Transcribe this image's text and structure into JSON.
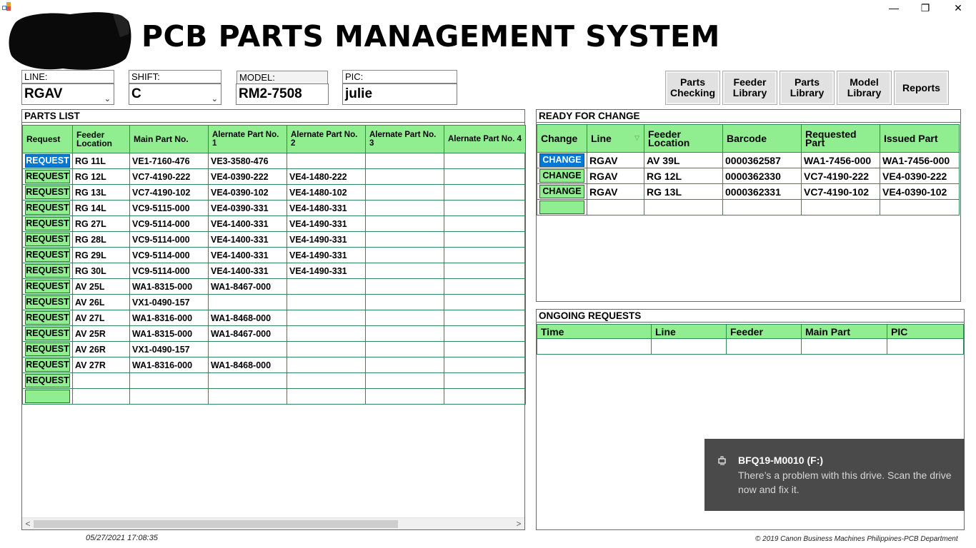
{
  "window": {
    "minimize_glyph": "—",
    "restore_glyph": "❐",
    "close_glyph": "✕"
  },
  "app_title": "PCB PARTS MANAGEMENT SYSTEM",
  "fields": {
    "line": {
      "label": "LINE:",
      "value": "RGAV"
    },
    "shift": {
      "label": "SHIFT:",
      "value": "C"
    },
    "model": {
      "label": "MODEL:",
      "value": "RM2-7508"
    },
    "pic": {
      "label": "PIC:",
      "value": "julie"
    }
  },
  "nav_buttons": [
    "Parts\nChecking",
    "Feeder\nLibrary",
    "Parts\nLibrary",
    "Model\nLibrary",
    "Reports"
  ],
  "parts_list": {
    "title": "PARTS LIST",
    "columns": [
      "Request",
      "Feeder Location",
      "Main Part No.",
      "Alernate Part No. 1",
      "Alernate Part No. 2",
      "Alernate Part No. 3",
      "Alernate Part No. 4"
    ],
    "button_label": "REQUEST",
    "rows": [
      {
        "feeder": "RG 11L",
        "main": "VE1-7160-476",
        "alt1": "VE3-3580-476",
        "alt2": "",
        "alt3": "",
        "alt4": "",
        "btn": "REQUEST"
      },
      {
        "feeder": "RG 12L",
        "main": "VC7-4190-222",
        "alt1": "VE4-0390-222",
        "alt2": "VE4-1480-222",
        "alt3": "",
        "alt4": "",
        "btn": "REQUEST"
      },
      {
        "feeder": "RG 13L",
        "main": "VC7-4190-102",
        "alt1": "VE4-0390-102",
        "alt2": "VE4-1480-102",
        "alt3": "",
        "alt4": "",
        "btn": "REQUEST"
      },
      {
        "feeder": "RG 14L",
        "main": "VC9-5115-000",
        "alt1": "VE4-0390-331",
        "alt2": "VE4-1480-331",
        "alt3": "",
        "alt4": "",
        "btn": "REQUEST"
      },
      {
        "feeder": "RG 27L",
        "main": "VC9-5114-000",
        "alt1": "VE4-1400-331",
        "alt2": "VE4-1490-331",
        "alt3": "",
        "alt4": "",
        "btn": "REQUEST"
      },
      {
        "feeder": "RG 28L",
        "main": "VC9-5114-000",
        "alt1": "VE4-1400-331",
        "alt2": "VE4-1490-331",
        "alt3": "",
        "alt4": "",
        "btn": "REQUEST"
      },
      {
        "feeder": "RG 29L",
        "main": "VC9-5114-000",
        "alt1": "VE4-1400-331",
        "alt2": "VE4-1490-331",
        "alt3": "",
        "alt4": "",
        "btn": "REQUEST"
      },
      {
        "feeder": "RG 30L",
        "main": "VC9-5114-000",
        "alt1": "VE4-1400-331",
        "alt2": "VE4-1490-331",
        "alt3": "",
        "alt4": "",
        "btn": "REQUEST"
      },
      {
        "feeder": "AV 25L",
        "main": "WA1-8315-000",
        "alt1": "WA1-8467-000",
        "alt2": "",
        "alt3": "",
        "alt4": "",
        "btn": "REQUEST"
      },
      {
        "feeder": "AV 26L",
        "main": "VX1-0490-157",
        "alt1": "",
        "alt2": "",
        "alt3": "",
        "alt4": "",
        "btn": "REQUEST"
      },
      {
        "feeder": "AV 27L",
        "main": "WA1-8316-000",
        "alt1": "WA1-8468-000",
        "alt2": "",
        "alt3": "",
        "alt4": "",
        "btn": "REQUEST"
      },
      {
        "feeder": "AV 25R",
        "main": "WA1-8315-000",
        "alt1": "WA1-8467-000",
        "alt2": "",
        "alt3": "",
        "alt4": "",
        "btn": "REQUEST"
      },
      {
        "feeder": "AV 26R",
        "main": "VX1-0490-157",
        "alt1": "",
        "alt2": "",
        "alt3": "",
        "alt4": "",
        "btn": "REQUEST"
      },
      {
        "feeder": "AV 27R",
        "main": "WA1-8316-000",
        "alt1": "WA1-8468-000",
        "alt2": "",
        "alt3": "",
        "alt4": "",
        "btn": "REQUEST"
      },
      {
        "feeder": "",
        "main": "",
        "alt1": "",
        "alt2": "",
        "alt3": "",
        "alt4": "",
        "btn": "REQUEST"
      },
      {
        "feeder": "",
        "main": "",
        "alt1": "",
        "alt2": "",
        "alt3": "",
        "alt4": "",
        "btn": ""
      }
    ],
    "scroll_left": "<",
    "scroll_right": ">"
  },
  "ready_for_change": {
    "title": "READY FOR CHANGE",
    "columns": [
      "Change",
      "Line",
      "Feeder Location",
      "Barcode",
      "Requested Part",
      "Issued Part"
    ],
    "rows": [
      {
        "btn": "CHANGE",
        "line": "RGAV",
        "feeder": "AV 39L",
        "barcode": "0000362587",
        "requested": "WA1-7456-000",
        "issued": "WA1-7456-000"
      },
      {
        "btn": "CHANGE",
        "line": "RGAV",
        "feeder": "RG 12L",
        "barcode": "0000362330",
        "requested": "VC7-4190-222",
        "issued": "VE4-0390-222"
      },
      {
        "btn": "CHANGE",
        "line": "RGAV",
        "feeder": "RG 13L",
        "barcode": "0000362331",
        "requested": "VC7-4190-102",
        "issued": "VE4-0390-102"
      },
      {
        "btn": "",
        "line": "",
        "feeder": "",
        "barcode": "",
        "requested": "",
        "issued": ""
      }
    ]
  },
  "ongoing_requests": {
    "title": "ONGOING REQUESTS",
    "columns": [
      "Time",
      "Line",
      "Feeder",
      "Main Part",
      "PIC"
    ]
  },
  "footer": {
    "timestamp": "05/27/2021 17:08:35",
    "copyright": "© 2019 Canon Business Machines Philippines-PCB Department"
  },
  "toast": {
    "title": "BFQ19-M0010 (F:)",
    "body": "There’s a problem with this drive.  Scan the drive now and fix it."
  },
  "colors": {
    "grid_header": "#90ee90",
    "grid_border": "#2e8b57",
    "selected_button": "#0078d7",
    "toast_bg": "#4a4a4a"
  }
}
